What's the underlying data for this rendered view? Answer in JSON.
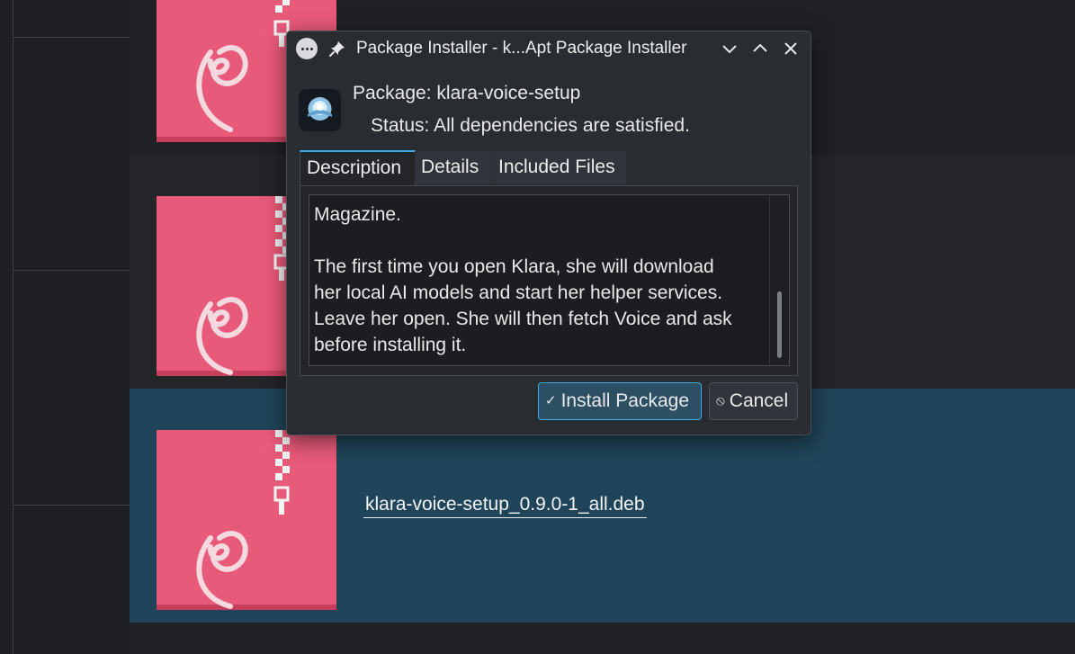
{
  "file_manager": {
    "selected_file_name": "klara-voice-setup_0.9.0-1_all.deb"
  },
  "dialog": {
    "title": "Package Installer - k...Apt Package Installer",
    "package_label": "Package:",
    "package_name": "klara-voice-setup",
    "status_label": "Status:",
    "status_text": "All dependencies are satisfied.",
    "tabs": [
      {
        "label": "Description",
        "active": true
      },
      {
        "label": "Details",
        "active": false
      },
      {
        "label": "Included Files",
        "active": false
      }
    ],
    "description_lines": [
      "Magazine.",
      "",
      "The first time you open Klara, she will download",
      "her local AI models and start her helper services.",
      "Leave her open. She will then fetch Voice and ask",
      "before installing it."
    ],
    "install_label": "Install Package",
    "cancel_label": "Cancel"
  },
  "colors": {
    "accent": "#3daee9",
    "selection_row": "#204459",
    "debian_red": "#e85a79"
  }
}
